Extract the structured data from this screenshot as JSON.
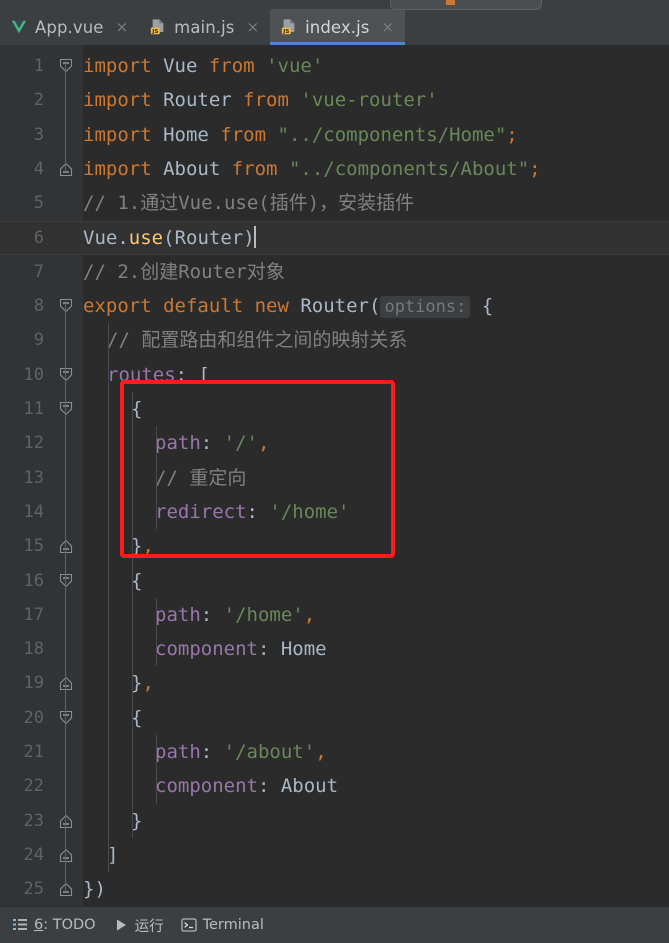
{
  "window": {
    "theme_bg": "#3c3f41",
    "editor_bg": "#2b2b2b",
    "gutter_bg": "#313335",
    "accent": "#4a88c7",
    "annotation_color": "#fc1c1c"
  },
  "tabs": [
    {
      "label": "App.vue",
      "icon": "vue-file-icon",
      "active": false,
      "close_glyph": "×"
    },
    {
      "label": "main.js",
      "icon": "js-file-icon",
      "active": false,
      "close_glyph": "×"
    },
    {
      "label": "index.js",
      "icon": "js-file-icon",
      "active": true,
      "close_glyph": "×"
    }
  ],
  "editor": {
    "language": "javascript",
    "caret_line": 6,
    "parameter_hint": "options:",
    "lines": [
      {
        "n": "1",
        "indent": 0,
        "fold": "start",
        "tokens": [
          {
            "t": "import ",
            "c": "kw"
          },
          {
            "t": "Vue",
            "c": "id"
          },
          {
            "t": " ",
            "c": "punct"
          },
          {
            "t": "from",
            "c": "kw"
          },
          {
            "t": " ",
            "c": "punct"
          },
          {
            "t": "'vue'",
            "c": "str"
          }
        ]
      },
      {
        "n": "2",
        "indent": 0,
        "fold": "",
        "tokens": [
          {
            "t": "import ",
            "c": "kw"
          },
          {
            "t": "Router",
            "c": "id"
          },
          {
            "t": " ",
            "c": "punct"
          },
          {
            "t": "from",
            "c": "kw"
          },
          {
            "t": " ",
            "c": "punct"
          },
          {
            "t": "'vue-router'",
            "c": "str"
          }
        ]
      },
      {
        "n": "3",
        "indent": 0,
        "fold": "",
        "tokens": [
          {
            "t": "import ",
            "c": "kw"
          },
          {
            "t": "Home",
            "c": "id"
          },
          {
            "t": " ",
            "c": "punct"
          },
          {
            "t": "from",
            "c": "kw"
          },
          {
            "t": " ",
            "c": "punct"
          },
          {
            "t": "\"../components/Home\"",
            "c": "str"
          },
          {
            "t": ";",
            "c": "comma"
          }
        ]
      },
      {
        "n": "4",
        "indent": 0,
        "fold": "end",
        "tokens": [
          {
            "t": "import ",
            "c": "kw"
          },
          {
            "t": "About",
            "c": "id"
          },
          {
            "t": " ",
            "c": "punct"
          },
          {
            "t": "from",
            "c": "kw"
          },
          {
            "t": " ",
            "c": "punct"
          },
          {
            "t": "\"../components/About\"",
            "c": "str"
          },
          {
            "t": ";",
            "c": "comma"
          }
        ]
      },
      {
        "n": "5",
        "indent": 0,
        "fold": "",
        "tokens": [
          {
            "t": "// 1.通过Vue.use(插件)，安装插件",
            "c": "cmt"
          }
        ]
      },
      {
        "n": "6",
        "indent": 0,
        "fold": "",
        "highlight": true,
        "caret": true,
        "tokens": [
          {
            "t": "Vue",
            "c": "id"
          },
          {
            "t": ".",
            "c": "punct"
          },
          {
            "t": "use",
            "c": "fn"
          },
          {
            "t": "(",
            "c": "punct"
          },
          {
            "t": "Router",
            "c": "id"
          },
          {
            "t": ")",
            "c": "punct"
          }
        ]
      },
      {
        "n": "7",
        "indent": 0,
        "fold": "",
        "tokens": [
          {
            "t": "// 2.创建Router对象",
            "c": "cmt"
          }
        ]
      },
      {
        "n": "8",
        "indent": 0,
        "fold": "start",
        "hint_after": 5,
        "tokens": [
          {
            "t": "export ",
            "c": "kw"
          },
          {
            "t": "default ",
            "c": "kw"
          },
          {
            "t": "new ",
            "c": "kw"
          },
          {
            "t": "Router",
            "c": "id"
          },
          {
            "t": "(",
            "c": "punct"
          }
        ]
      },
      {
        "n": "9",
        "indent": 1,
        "fold": "",
        "tokens": [
          {
            "t": "// 配置路由和组件之间的映射关系",
            "c": "cmt"
          }
        ]
      },
      {
        "n": "10",
        "indent": 1,
        "fold": "start",
        "tokens": [
          {
            "t": "routes",
            "c": "prop"
          },
          {
            "t": ":",
            "c": "punct"
          },
          {
            "t": " ",
            "c": "punct"
          },
          {
            "t": "[",
            "c": "brace"
          }
        ]
      },
      {
        "n": "11",
        "indent": 2,
        "fold": "start",
        "tokens": [
          {
            "t": "{",
            "c": "brace"
          }
        ]
      },
      {
        "n": "12",
        "indent": 3,
        "fold": "",
        "tokens": [
          {
            "t": "path",
            "c": "prop"
          },
          {
            "t": ":",
            "c": "punct"
          },
          {
            "t": " ",
            "c": "punct"
          },
          {
            "t": "'/'",
            "c": "str"
          },
          {
            "t": ",",
            "c": "comma"
          }
        ]
      },
      {
        "n": "13",
        "indent": 3,
        "fold": "",
        "tokens": [
          {
            "t": "// 重定向",
            "c": "cmt"
          }
        ]
      },
      {
        "n": "14",
        "indent": 3,
        "fold": "",
        "tokens": [
          {
            "t": "redirect",
            "c": "prop"
          },
          {
            "t": ":",
            "c": "punct"
          },
          {
            "t": " ",
            "c": "punct"
          },
          {
            "t": "'/home'",
            "c": "str"
          }
        ]
      },
      {
        "n": "15",
        "indent": 2,
        "fold": "end",
        "tokens": [
          {
            "t": "}",
            "c": "brace"
          },
          {
            "t": ",",
            "c": "comma"
          }
        ]
      },
      {
        "n": "16",
        "indent": 2,
        "fold": "start",
        "tokens": [
          {
            "t": "{",
            "c": "brace"
          }
        ]
      },
      {
        "n": "17",
        "indent": 3,
        "fold": "",
        "tokens": [
          {
            "t": "path",
            "c": "prop"
          },
          {
            "t": ":",
            "c": "punct"
          },
          {
            "t": " ",
            "c": "punct"
          },
          {
            "t": "'/home'",
            "c": "str"
          },
          {
            "t": ",",
            "c": "comma"
          }
        ]
      },
      {
        "n": "18",
        "indent": 3,
        "fold": "",
        "tokens": [
          {
            "t": "component",
            "c": "prop"
          },
          {
            "t": ":",
            "c": "punct"
          },
          {
            "t": " ",
            "c": "punct"
          },
          {
            "t": "Home",
            "c": "id"
          }
        ]
      },
      {
        "n": "19",
        "indent": 2,
        "fold": "end",
        "tokens": [
          {
            "t": "}",
            "c": "brace"
          },
          {
            "t": ",",
            "c": "comma"
          }
        ]
      },
      {
        "n": "20",
        "indent": 2,
        "fold": "start",
        "tokens": [
          {
            "t": "{",
            "c": "brace"
          }
        ]
      },
      {
        "n": "21",
        "indent": 3,
        "fold": "",
        "tokens": [
          {
            "t": "path",
            "c": "prop"
          },
          {
            "t": ":",
            "c": "punct"
          },
          {
            "t": " ",
            "c": "punct"
          },
          {
            "t": "'/about'",
            "c": "str"
          },
          {
            "t": ",",
            "c": "comma"
          }
        ]
      },
      {
        "n": "22",
        "indent": 3,
        "fold": "",
        "tokens": [
          {
            "t": "component",
            "c": "prop"
          },
          {
            "t": ":",
            "c": "punct"
          },
          {
            "t": " ",
            "c": "punct"
          },
          {
            "t": "About",
            "c": "id"
          }
        ]
      },
      {
        "n": "23",
        "indent": 2,
        "fold": "end",
        "tokens": [
          {
            "t": "}",
            "c": "brace"
          }
        ]
      },
      {
        "n": "24",
        "indent": 1,
        "fold": "end",
        "tokens": [
          {
            "t": "]",
            "c": "brace"
          }
        ]
      },
      {
        "n": "25",
        "indent": 0,
        "fold": "end",
        "tokens": [
          {
            "t": "}",
            "c": "brace"
          },
          {
            "t": ")",
            "c": "punct"
          }
        ]
      }
    ]
  },
  "annotation": {
    "shape": "rectangle",
    "color": "#fc1c1c",
    "covers_lines": [
      "11",
      "12",
      "13",
      "14",
      "15"
    ]
  },
  "statusbar": {
    "items": [
      {
        "label": "6: TODO",
        "icon": "todo-list-icon",
        "underline_prefix": "6"
      },
      {
        "label": "运行",
        "icon": "run-play-icon"
      },
      {
        "label": "Terminal",
        "icon": "terminal-icon"
      }
    ]
  }
}
